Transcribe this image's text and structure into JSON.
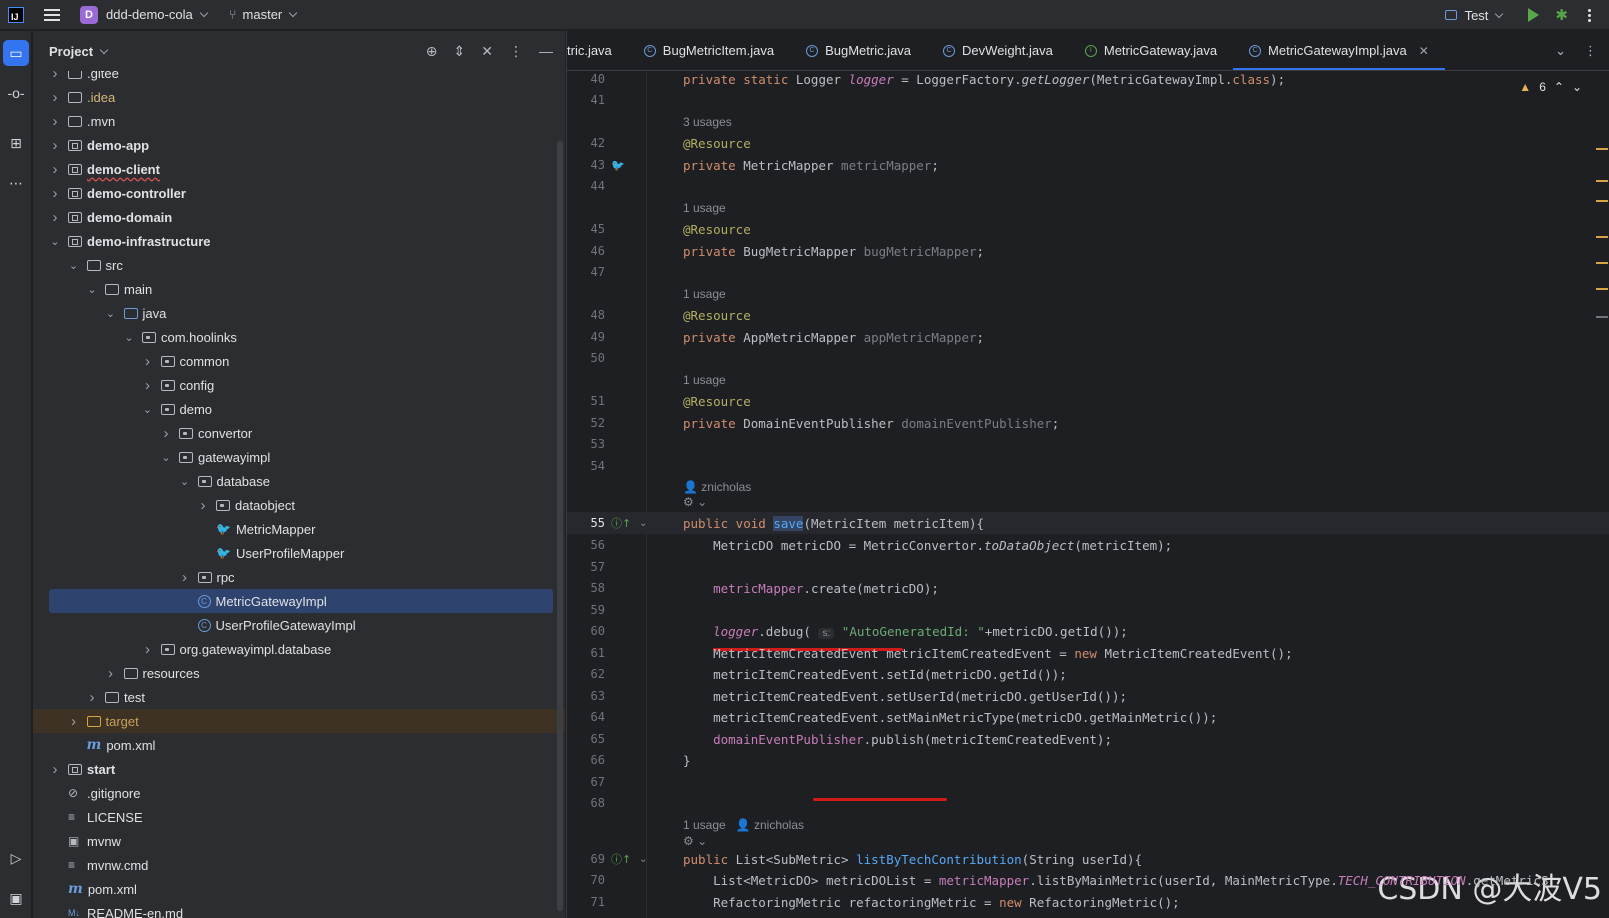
{
  "titlebar": {
    "logo": "IJ",
    "project_initial": "D",
    "project_name": "ddd-demo-cola",
    "branch": "master",
    "run_config": "Test"
  },
  "project_panel": {
    "title": "Project",
    "tree": [
      {
        "label": ".gitee",
        "depth": 2,
        "arrow": ">",
        "icon": "folder"
      },
      {
        "label": ".idea",
        "depth": 2,
        "arrow": ">",
        "icon": "folder",
        "style": "yellow"
      },
      {
        "label": ".mvn",
        "depth": 2,
        "arrow": ">",
        "icon": "folder"
      },
      {
        "label": "demo-app",
        "depth": 2,
        "arrow": ">",
        "icon": "module",
        "style": "bold"
      },
      {
        "label": "demo-client",
        "depth": 2,
        "arrow": ">",
        "icon": "module",
        "style": "bold squiggle"
      },
      {
        "label": "demo-controller",
        "depth": 2,
        "arrow": ">",
        "icon": "module",
        "style": "bold"
      },
      {
        "label": "demo-domain",
        "depth": 2,
        "arrow": ">",
        "icon": "module",
        "style": "bold"
      },
      {
        "label": "demo-infrastructure",
        "depth": 2,
        "arrow": "v",
        "icon": "module",
        "style": "bold"
      },
      {
        "label": "src",
        "depth": 3,
        "arrow": "v",
        "icon": "folder"
      },
      {
        "label": "main",
        "depth": 4,
        "arrow": "v",
        "icon": "folder"
      },
      {
        "label": "java",
        "depth": 5,
        "arrow": "v",
        "icon": "folder-blue"
      },
      {
        "label": "com.hoolinks",
        "depth": 6,
        "arrow": "v",
        "icon": "package"
      },
      {
        "label": "common",
        "depth": 7,
        "arrow": ">",
        "icon": "package"
      },
      {
        "label": "config",
        "depth": 7,
        "arrow": ">",
        "icon": "package"
      },
      {
        "label": "demo",
        "depth": 7,
        "arrow": "v",
        "icon": "package"
      },
      {
        "label": "convertor",
        "depth": 8,
        "arrow": ">",
        "icon": "package"
      },
      {
        "label": "gatewayimpl",
        "depth": 8,
        "arrow": "v",
        "icon": "package"
      },
      {
        "label": "database",
        "depth": 9,
        "arrow": "v",
        "icon": "package"
      },
      {
        "label": "dataobject",
        "depth": 10,
        "arrow": ">",
        "icon": "package"
      },
      {
        "label": "MetricMapper",
        "depth": 10,
        "arrow": "",
        "icon": "mybatis"
      },
      {
        "label": "UserProfileMapper",
        "depth": 10,
        "arrow": "",
        "icon": "mybatis"
      },
      {
        "label": "rpc",
        "depth": 9,
        "arrow": ">",
        "icon": "package"
      },
      {
        "label": "MetricGatewayImpl",
        "depth": 9,
        "arrow": "",
        "icon": "class",
        "selected": true
      },
      {
        "label": "UserProfileGatewayImpl",
        "depth": 9,
        "arrow": "",
        "icon": "class"
      },
      {
        "label": "org.gatewayimpl.database",
        "depth": 7,
        "arrow": ">",
        "icon": "package"
      },
      {
        "label": "resources",
        "depth": 5,
        "arrow": ">",
        "icon": "folder"
      },
      {
        "label": "test",
        "depth": 4,
        "arrow": ">",
        "icon": "folder"
      },
      {
        "label": "target",
        "depth": 3,
        "arrow": ">",
        "icon": "folder-orange",
        "style": "orange",
        "target": true
      },
      {
        "label": "pom.xml",
        "depth": 3,
        "arrow": "",
        "icon": "maven"
      },
      {
        "label": "start",
        "depth": 2,
        "arrow": ">",
        "icon": "module",
        "style": "bold"
      },
      {
        "label": ".gitignore",
        "depth": 2,
        "arrow": "",
        "icon": "ignore"
      },
      {
        "label": "LICENSE",
        "depth": 2,
        "arrow": "",
        "icon": "text"
      },
      {
        "label": "mvnw",
        "depth": 2,
        "arrow": "",
        "icon": "shell"
      },
      {
        "label": "mvnw.cmd",
        "depth": 2,
        "arrow": "",
        "icon": "text"
      },
      {
        "label": "pom.xml",
        "depth": 2,
        "arrow": "",
        "icon": "maven"
      },
      {
        "label": "README-en.md",
        "depth": 2,
        "arrow": "",
        "icon": "md"
      }
    ]
  },
  "editor": {
    "tabs": [
      {
        "label": "tric.java",
        "icon": "none"
      },
      {
        "label": "BugMetricItem.java",
        "icon": "class"
      },
      {
        "label": "BugMetric.java",
        "icon": "class"
      },
      {
        "label": "DevWeight.java",
        "icon": "class"
      },
      {
        "label": "MetricGateway.java",
        "icon": "interface"
      },
      {
        "label": "MetricGatewayImpl.java",
        "icon": "class",
        "active": true
      }
    ],
    "warning_count": "6",
    "watermark": "CSDN @大波V5",
    "lines": [
      {
        "n": "40",
        "html": "<span class='kw'>private static</span> Logger <span class='st'>logger</span> = LoggerFactory.<span class='ital'>getLogger</span>(MetricGatewayImpl.<span class='kw'>class</span>);"
      },
      {
        "n": "41",
        "html": ""
      },
      {
        "hint": "3 usages"
      },
      {
        "n": "42",
        "html": "<span class='ann'>@Resource</span>"
      },
      {
        "n": "43",
        "html": "<span class='kw'>private</span> MetricMapper <span class='muted'>metricMapper</span>;",
        "gicon": "bird"
      },
      {
        "n": "44",
        "html": ""
      },
      {
        "hint": "1 usage"
      },
      {
        "n": "45",
        "html": "<span class='ann'>@Resource</span>"
      },
      {
        "n": "46",
        "html": "<span class='kw'>private</span> BugMetricMapper <span class='muted'>bugMetricMapper</span>;"
      },
      {
        "n": "47",
        "html": ""
      },
      {
        "hint": "1 usage"
      },
      {
        "n": "48",
        "html": "<span class='ann'>@Resource</span>"
      },
      {
        "n": "49",
        "html": "<span class='kw'>private</span> AppMetricMapper <span class='muted'>appMetricMapper</span>;"
      },
      {
        "n": "50",
        "html": ""
      },
      {
        "hint": "1 usage"
      },
      {
        "n": "51",
        "html": "<span class='ann'>@Resource</span>"
      },
      {
        "n": "52",
        "html": "<span class='kw'>private</span> DomainEventPublisher <span class='muted'>domainEventPublisher</span>;"
      },
      {
        "n": "53",
        "html": ""
      },
      {
        "n": "54",
        "html": ""
      },
      {
        "hint": "👤 znicholas"
      },
      {
        "hint": "⚙ ⌄"
      },
      {
        "n": "55",
        "html": "<span class='kw'>public void</span> <span class='saveh'>save</span>(MetricItem metricItem){",
        "gicon": "impl",
        "current": true
      },
      {
        "n": "56",
        "html": "    MetricDO metricDO = MetricConvertor.<span class='ital'>toDataObject</span>(metricItem);"
      },
      {
        "n": "57",
        "html": ""
      },
      {
        "n": "58",
        "html": "    <span class='fld'>metricMapper</span>.create(metricDO);"
      },
      {
        "n": "59",
        "html": ""
      },
      {
        "n": "60",
        "html": "    <span class='st'>logger</span>.debug( <span class='param'>s:</span> <span class='str'>\"AutoGeneratedId: \"</span>+metricDO.getId());"
      },
      {
        "n": "61",
        "html": "    MetricItemCreatedEvent metricItemCreatedEvent = <span class='kw'>new</span> MetricItemCreatedEvent();"
      },
      {
        "n": "62",
        "html": "    metricItemCreatedEvent.setId(metricDO.getId());"
      },
      {
        "n": "63",
        "html": "    metricItemCreatedEvent.setUserId(metricDO.getUserId());"
      },
      {
        "n": "64",
        "html": "    metricItemCreatedEvent.setMainMetricType(metricDO.getMainMetric());"
      },
      {
        "n": "65",
        "html": "    <span class='fld'>domainEventPublisher</span>.publish(metricItemCreatedEvent);"
      },
      {
        "n": "66",
        "html": "}"
      },
      {
        "n": "67",
        "html": ""
      },
      {
        "n": "68",
        "html": ""
      },
      {
        "hint": "1 usage   👤 znicholas"
      },
      {
        "hint": "⚙ ⌄"
      },
      {
        "n": "69",
        "html": "<span class='kw'>public</span> List&lt;SubMetric&gt; <span class='fn'>listByTechContribution</span>(String userId){",
        "gicon": "impl"
      },
      {
        "n": "70",
        "html": "    List&lt;MetricDO&gt; metricDOList = <span class='fld'>metricMapper</span>.listByMainMetric(userId, MainMetricType.<span class='st'>TECH_CONTRIBUTION</span>.getMetricS"
      },
      {
        "n": "71",
        "html": "    RefactoringMetric refactoringMetric = <span class='kw'>new</span> RefactoringMetric();"
      }
    ]
  }
}
